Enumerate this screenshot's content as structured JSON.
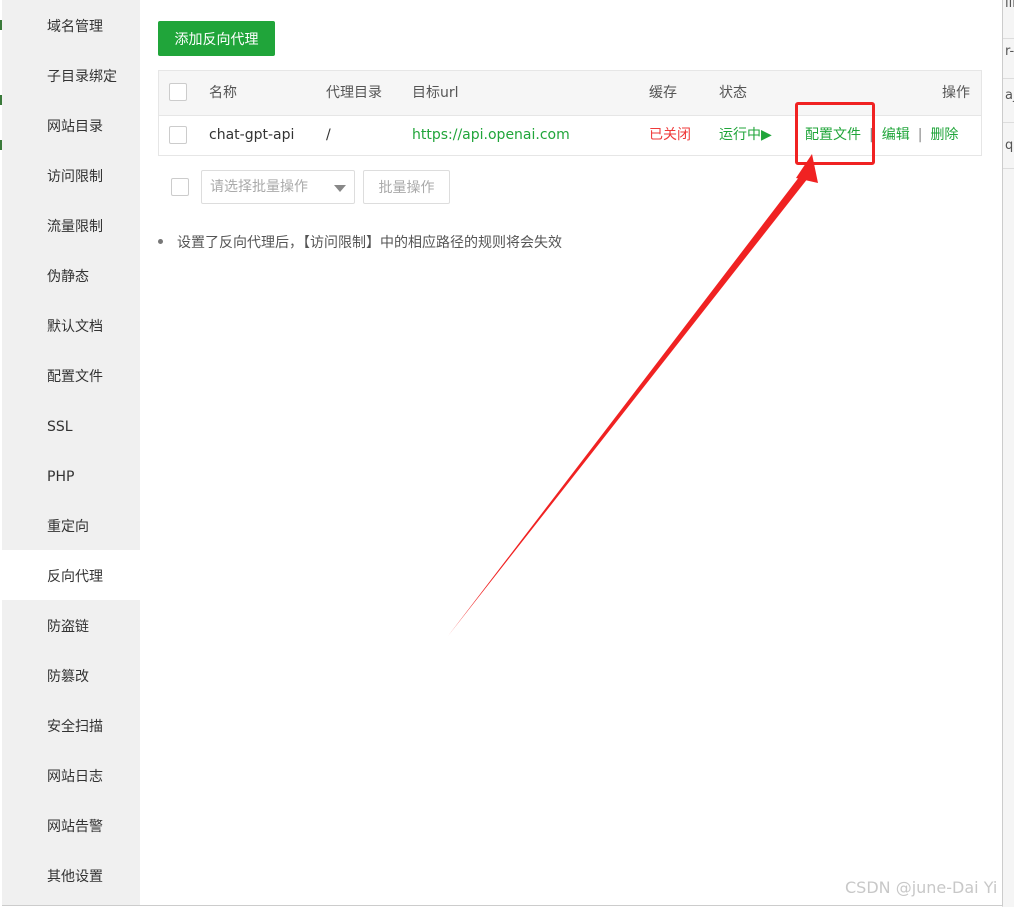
{
  "sidebar": {
    "items": [
      {
        "label": "域名管理"
      },
      {
        "label": "子目录绑定"
      },
      {
        "label": "网站目录"
      },
      {
        "label": "访问限制"
      },
      {
        "label": "流量限制"
      },
      {
        "label": "伪静态"
      },
      {
        "label": "默认文档"
      },
      {
        "label": "配置文件"
      },
      {
        "label": "SSL"
      },
      {
        "label": "PHP"
      },
      {
        "label": "重定向"
      },
      {
        "label": "反向代理",
        "active": true
      },
      {
        "label": "防盗链"
      },
      {
        "label": "防篡改"
      },
      {
        "label": "安全扫描"
      },
      {
        "label": "网站日志"
      },
      {
        "label": "网站告警"
      },
      {
        "label": "其他设置"
      }
    ]
  },
  "toolbar": {
    "add_label": "添加反向代理"
  },
  "table": {
    "headers": {
      "name": "名称",
      "dir": "代理目录",
      "url": "目标url",
      "cache": "缓存",
      "status": "状态",
      "ops": "操作"
    },
    "rows": [
      {
        "name": "chat-gpt-api",
        "dir": "/",
        "url": "https://api.openai.com",
        "cache": "已关闭",
        "status": "运行中▶",
        "op_config": "配置文件",
        "op_sep1": "|",
        "op_edit": "编辑",
        "op_sep2": "|",
        "op_delete": "删除"
      }
    ]
  },
  "batch": {
    "placeholder": "请选择批量操作",
    "button_label": "批量操作"
  },
  "tips": [
    "设置了反向代理后，【访问限制】中的相应路径的规则将会失效"
  ],
  "watermark": "CSDN @june-Dai Yi",
  "background_fragments": [
    "lir",
    "r-p",
    "aj",
    "qi"
  ],
  "colors": {
    "accent_green": "#20a53a",
    "status_red": "#ef3a3a",
    "annotation_red": "#f02222",
    "sidebar_bg": "#f0f0f0"
  }
}
